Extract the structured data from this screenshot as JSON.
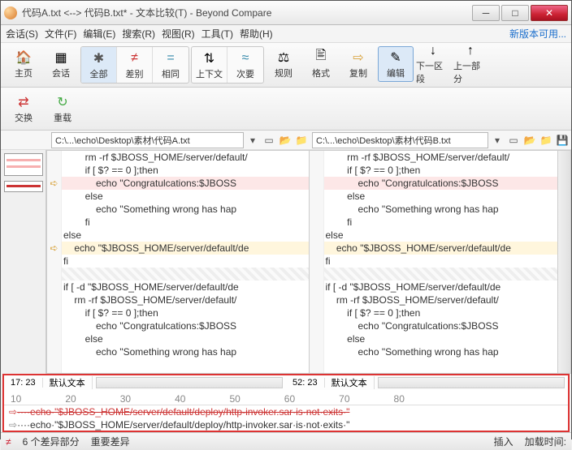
{
  "title": "代码A.txt <--> 代码B.txt* - 文本比较(T) - Beyond Compare",
  "menu": {
    "session": "会话(S)",
    "file": "文件(F)",
    "edit": "编辑(E)",
    "search": "搜索(R)",
    "view": "视图(R)",
    "tools": "工具(T)",
    "help": "帮助(H)",
    "update": "新版本可用..."
  },
  "tb": {
    "home": "主页",
    "session": "会话",
    "all": "全部",
    "diff": "差别",
    "same": "相同",
    "context": "上下文",
    "next": "次要",
    "rules": "规则",
    "format": "格式",
    "copy": "复制",
    "edit": "编辑",
    "nextsec": "下一区段",
    "prevpart": "上一部分",
    "swap": "交换",
    "reload": "重载"
  },
  "paths": {
    "left": "C:\\...\\echo\\Desktop\\素材\\代码A.txt",
    "right": "C:\\...\\echo\\Desktop\\素材\\代码B.txt"
  },
  "code": {
    "lines": [
      {
        "t": "        rm -rf $JBOSS_HOME/server/default/",
        "cls": ""
      },
      {
        "t": "        if [ $? == 0 ];then",
        "cls": ""
      },
      {
        "t": "            echo \"Congratulcations:$JBOSS",
        "cls": "diff",
        "ar": "➪"
      },
      {
        "t": "        else",
        "cls": ""
      },
      {
        "t": "            echo \"Something wrong has hap",
        "cls": ""
      },
      {
        "t": "        fi",
        "cls": ""
      },
      {
        "t": "else",
        "cls": ""
      },
      {
        "t": "    echo \"$JBOSS_HOME/server/default/de",
        "cls": "mark",
        "ar": "➪"
      },
      {
        "t": "fi",
        "cls": ""
      },
      {
        "t": "",
        "cls": "hatch"
      },
      {
        "t": "if [ -d \"$JBOSS_HOME/server/default/de",
        "cls": ""
      },
      {
        "t": "    rm -rf $JBOSS_HOME/server/default/",
        "cls": ""
      },
      {
        "t": "        if [ $? == 0 ];then",
        "cls": ""
      },
      {
        "t": "            echo \"Congratulcations:$JBOSS",
        "cls": ""
      },
      {
        "t": "        else",
        "cls": ""
      },
      {
        "t": "            echo \"Something wrong has hap",
        "cls": ""
      }
    ],
    "rlines": [
      {
        "t": "        rm -rf $JBOSS_HOME/server/default/",
        "cls": ""
      },
      {
        "t": "        if [ $? == 0 ];then",
        "cls": ""
      },
      {
        "t": "            echo \"Congratulcations:$JBOSS",
        "cls": "diff"
      },
      {
        "t": "        else",
        "cls": ""
      },
      {
        "t": "            echo \"Something wrong has hap",
        "cls": ""
      },
      {
        "t": "        fi",
        "cls": ""
      },
      {
        "t": "else",
        "cls": ""
      },
      {
        "t": "    echo \"$JBOSS_HOME/server/default/de",
        "cls": "mark"
      },
      {
        "t": "fi",
        "cls": ""
      },
      {
        "t": "",
        "cls": "hatch"
      },
      {
        "t": "if [ -d \"$JBOSS_HOME/server/default/de",
        "cls": ""
      },
      {
        "t": "    rm -rf $JBOSS_HOME/server/default/",
        "cls": ""
      },
      {
        "t": "        if [ $? == 0 ];then",
        "cls": ""
      },
      {
        "t": "            echo \"Congratulcations:$JBOSS",
        "cls": ""
      },
      {
        "t": "        else",
        "cls": ""
      },
      {
        "t": "            echo \"Something wrong has hap",
        "cls": ""
      }
    ]
  },
  "stat": {
    "lpos": "17: 23",
    "rpos": "52: 23",
    "enc": "默认文本"
  },
  "ruler": [
    "10",
    "20",
    "30",
    "40",
    "50",
    "60",
    "70",
    "80"
  ],
  "inline": {
    "a": "····echo·\"$JBOSS_HOME/server/default/deploy/http-invoker.sar·is·not·exits·\"",
    "b": "····echo·\"$JBOSS_HOME/server/default/deploy/http-invoker.sar·is·not·exits·\""
  },
  "status": {
    "diffs": "6 个差异部分",
    "major": "重要差异",
    "insert": "插入",
    "load": "加载时间:"
  }
}
